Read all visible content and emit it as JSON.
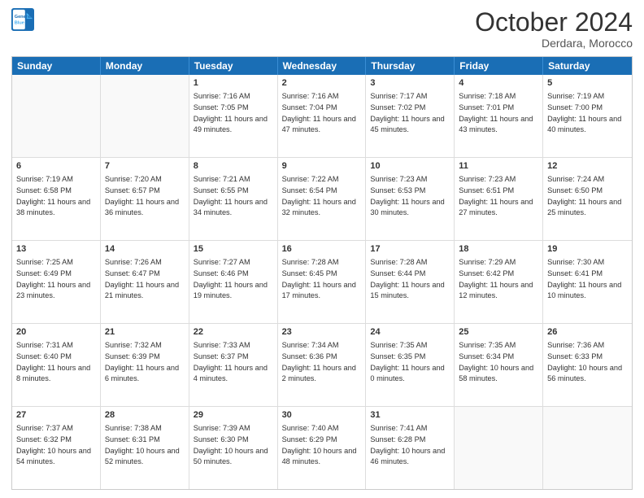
{
  "header": {
    "logo_line1": "General",
    "logo_line2": "Blue",
    "month": "October 2024",
    "location": "Derdara, Morocco"
  },
  "days_of_week": [
    "Sunday",
    "Monday",
    "Tuesday",
    "Wednesday",
    "Thursday",
    "Friday",
    "Saturday"
  ],
  "rows": [
    [
      {
        "day": "",
        "sunrise": "",
        "sunset": "",
        "daylight": "",
        "empty": true
      },
      {
        "day": "",
        "sunrise": "",
        "sunset": "",
        "daylight": "",
        "empty": true
      },
      {
        "day": "1",
        "sunrise": "Sunrise: 7:16 AM",
        "sunset": "Sunset: 7:05 PM",
        "daylight": "Daylight: 11 hours and 49 minutes."
      },
      {
        "day": "2",
        "sunrise": "Sunrise: 7:16 AM",
        "sunset": "Sunset: 7:04 PM",
        "daylight": "Daylight: 11 hours and 47 minutes."
      },
      {
        "day": "3",
        "sunrise": "Sunrise: 7:17 AM",
        "sunset": "Sunset: 7:02 PM",
        "daylight": "Daylight: 11 hours and 45 minutes."
      },
      {
        "day": "4",
        "sunrise": "Sunrise: 7:18 AM",
        "sunset": "Sunset: 7:01 PM",
        "daylight": "Daylight: 11 hours and 43 minutes."
      },
      {
        "day": "5",
        "sunrise": "Sunrise: 7:19 AM",
        "sunset": "Sunset: 7:00 PM",
        "daylight": "Daylight: 11 hours and 40 minutes."
      }
    ],
    [
      {
        "day": "6",
        "sunrise": "Sunrise: 7:19 AM",
        "sunset": "Sunset: 6:58 PM",
        "daylight": "Daylight: 11 hours and 38 minutes."
      },
      {
        "day": "7",
        "sunrise": "Sunrise: 7:20 AM",
        "sunset": "Sunset: 6:57 PM",
        "daylight": "Daylight: 11 hours and 36 minutes."
      },
      {
        "day": "8",
        "sunrise": "Sunrise: 7:21 AM",
        "sunset": "Sunset: 6:55 PM",
        "daylight": "Daylight: 11 hours and 34 minutes."
      },
      {
        "day": "9",
        "sunrise": "Sunrise: 7:22 AM",
        "sunset": "Sunset: 6:54 PM",
        "daylight": "Daylight: 11 hours and 32 minutes."
      },
      {
        "day": "10",
        "sunrise": "Sunrise: 7:23 AM",
        "sunset": "Sunset: 6:53 PM",
        "daylight": "Daylight: 11 hours and 30 minutes."
      },
      {
        "day": "11",
        "sunrise": "Sunrise: 7:23 AM",
        "sunset": "Sunset: 6:51 PM",
        "daylight": "Daylight: 11 hours and 27 minutes."
      },
      {
        "day": "12",
        "sunrise": "Sunrise: 7:24 AM",
        "sunset": "Sunset: 6:50 PM",
        "daylight": "Daylight: 11 hours and 25 minutes."
      }
    ],
    [
      {
        "day": "13",
        "sunrise": "Sunrise: 7:25 AM",
        "sunset": "Sunset: 6:49 PM",
        "daylight": "Daylight: 11 hours and 23 minutes."
      },
      {
        "day": "14",
        "sunrise": "Sunrise: 7:26 AM",
        "sunset": "Sunset: 6:47 PM",
        "daylight": "Daylight: 11 hours and 21 minutes."
      },
      {
        "day": "15",
        "sunrise": "Sunrise: 7:27 AM",
        "sunset": "Sunset: 6:46 PM",
        "daylight": "Daylight: 11 hours and 19 minutes."
      },
      {
        "day": "16",
        "sunrise": "Sunrise: 7:28 AM",
        "sunset": "Sunset: 6:45 PM",
        "daylight": "Daylight: 11 hours and 17 minutes."
      },
      {
        "day": "17",
        "sunrise": "Sunrise: 7:28 AM",
        "sunset": "Sunset: 6:44 PM",
        "daylight": "Daylight: 11 hours and 15 minutes."
      },
      {
        "day": "18",
        "sunrise": "Sunrise: 7:29 AM",
        "sunset": "Sunset: 6:42 PM",
        "daylight": "Daylight: 11 hours and 12 minutes."
      },
      {
        "day": "19",
        "sunrise": "Sunrise: 7:30 AM",
        "sunset": "Sunset: 6:41 PM",
        "daylight": "Daylight: 11 hours and 10 minutes."
      }
    ],
    [
      {
        "day": "20",
        "sunrise": "Sunrise: 7:31 AM",
        "sunset": "Sunset: 6:40 PM",
        "daylight": "Daylight: 11 hours and 8 minutes."
      },
      {
        "day": "21",
        "sunrise": "Sunrise: 7:32 AM",
        "sunset": "Sunset: 6:39 PM",
        "daylight": "Daylight: 11 hours and 6 minutes."
      },
      {
        "day": "22",
        "sunrise": "Sunrise: 7:33 AM",
        "sunset": "Sunset: 6:37 PM",
        "daylight": "Daylight: 11 hours and 4 minutes."
      },
      {
        "day": "23",
        "sunrise": "Sunrise: 7:34 AM",
        "sunset": "Sunset: 6:36 PM",
        "daylight": "Daylight: 11 hours and 2 minutes."
      },
      {
        "day": "24",
        "sunrise": "Sunrise: 7:35 AM",
        "sunset": "Sunset: 6:35 PM",
        "daylight": "Daylight: 11 hours and 0 minutes."
      },
      {
        "day": "25",
        "sunrise": "Sunrise: 7:35 AM",
        "sunset": "Sunset: 6:34 PM",
        "daylight": "Daylight: 10 hours and 58 minutes."
      },
      {
        "day": "26",
        "sunrise": "Sunrise: 7:36 AM",
        "sunset": "Sunset: 6:33 PM",
        "daylight": "Daylight: 10 hours and 56 minutes."
      }
    ],
    [
      {
        "day": "27",
        "sunrise": "Sunrise: 7:37 AM",
        "sunset": "Sunset: 6:32 PM",
        "daylight": "Daylight: 10 hours and 54 minutes."
      },
      {
        "day": "28",
        "sunrise": "Sunrise: 7:38 AM",
        "sunset": "Sunset: 6:31 PM",
        "daylight": "Daylight: 10 hours and 52 minutes."
      },
      {
        "day": "29",
        "sunrise": "Sunrise: 7:39 AM",
        "sunset": "Sunset: 6:30 PM",
        "daylight": "Daylight: 10 hours and 50 minutes."
      },
      {
        "day": "30",
        "sunrise": "Sunrise: 7:40 AM",
        "sunset": "Sunset: 6:29 PM",
        "daylight": "Daylight: 10 hours and 48 minutes."
      },
      {
        "day": "31",
        "sunrise": "Sunrise: 7:41 AM",
        "sunset": "Sunset: 6:28 PM",
        "daylight": "Daylight: 10 hours and 46 minutes."
      },
      {
        "day": "",
        "sunrise": "",
        "sunset": "",
        "daylight": "",
        "empty": true
      },
      {
        "day": "",
        "sunrise": "",
        "sunset": "",
        "daylight": "",
        "empty": true
      }
    ]
  ]
}
